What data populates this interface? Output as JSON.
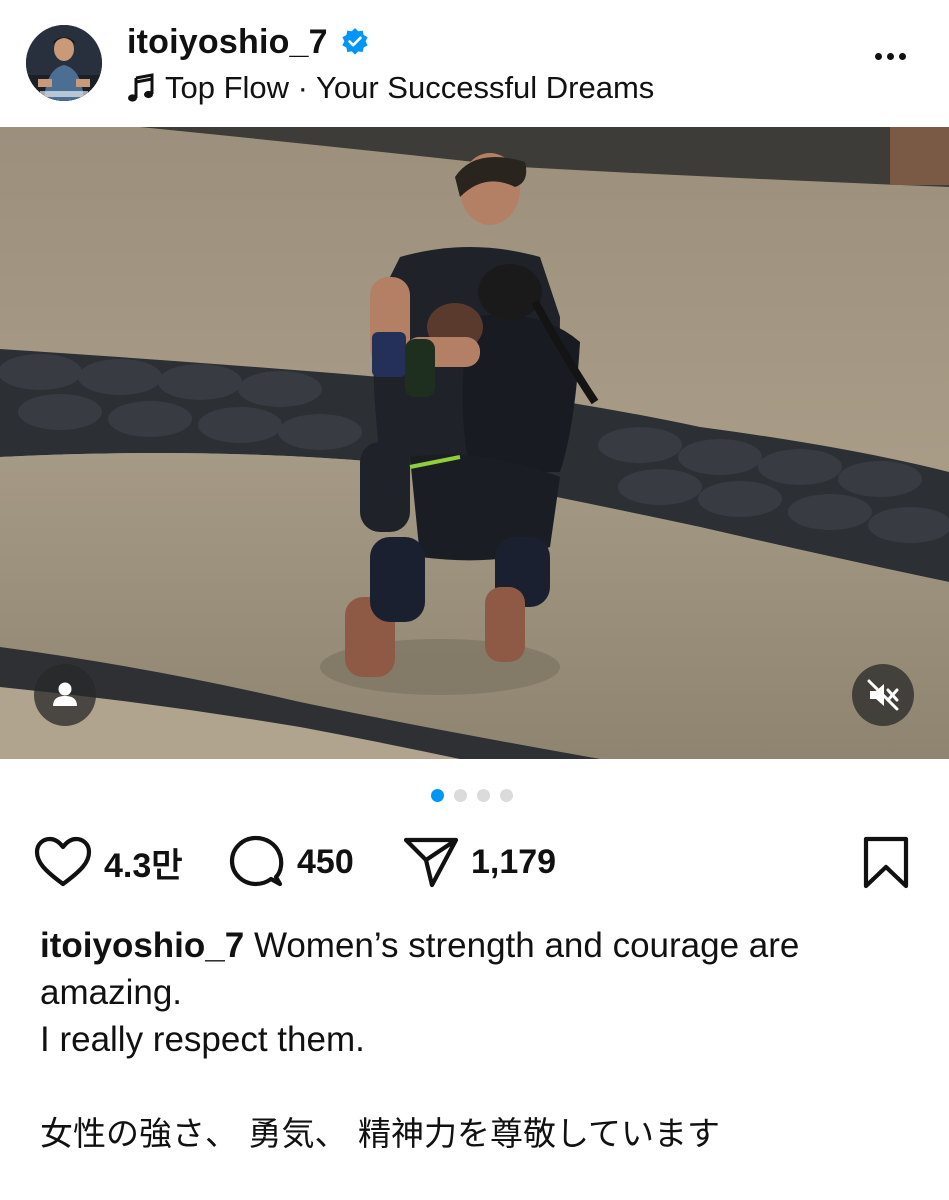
{
  "header": {
    "username": "itoiyoshio_7",
    "verified": true,
    "music": "Top Flow · Your Successful Dreams",
    "icons": {
      "verified": "verified-badge-icon",
      "music": "music-note-icon",
      "more": "more-options-icon"
    }
  },
  "post": {
    "photo_description_icon": "tag-people-icon",
    "mute_icon": "muted-speaker-icon",
    "carousel": {
      "total": 4,
      "active": 1
    }
  },
  "actions": {
    "likes": "4.3만",
    "comments": "450",
    "shares": "1,179",
    "icons": {
      "like": "heart-icon",
      "comment": "comment-icon",
      "share": "send-icon",
      "save": "bookmark-icon"
    }
  },
  "caption": {
    "username": "itoiyoshio_7",
    "text_line1": " Women’s strength and courage are amazing.",
    "text_line2": "I really respect them.",
    "text_jp": "女性の強さ、 勇気、 精神力を尊敬しています"
  },
  "colors": {
    "accent": "#0095f6",
    "text": "#111111",
    "dot_inactive": "#dbdbdb"
  }
}
